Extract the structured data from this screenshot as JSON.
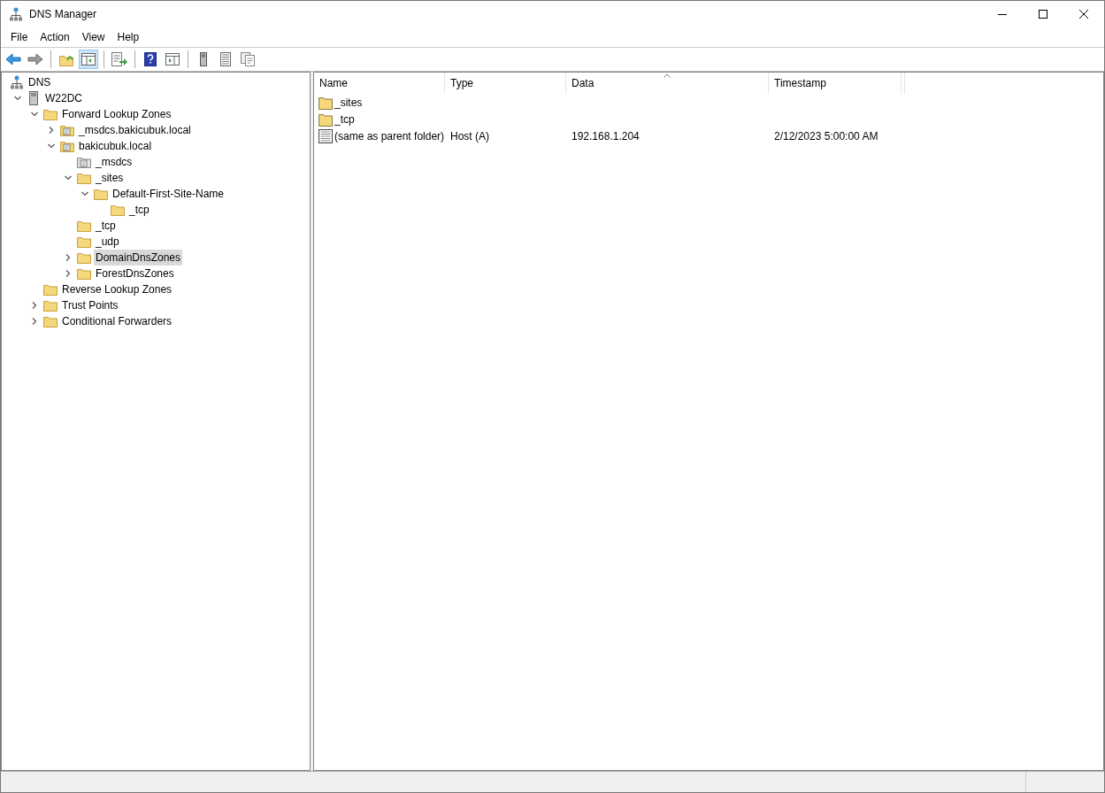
{
  "window": {
    "title": "DNS Manager"
  },
  "menu": [
    "File",
    "Action",
    "View",
    "Help"
  ],
  "toolbar": [
    {
      "kind": "back",
      "pressed": false
    },
    {
      "kind": "forward",
      "pressed": false
    },
    {
      "kind": "separator"
    },
    {
      "kind": "up",
      "pressed": false
    },
    {
      "kind": "tree",
      "pressed": true
    },
    {
      "kind": "separator"
    },
    {
      "kind": "export",
      "pressed": false
    },
    {
      "kind": "separator"
    },
    {
      "kind": "help",
      "pressed": false
    },
    {
      "kind": "pane",
      "pressed": false
    },
    {
      "kind": "separator"
    },
    {
      "kind": "server",
      "pressed": false
    },
    {
      "kind": "list",
      "pressed": false
    },
    {
      "kind": "copy",
      "pressed": false
    }
  ],
  "tree": {
    "label": "DNS",
    "kind": "dns",
    "selected": false,
    "children": [
      {
        "label": "W22DC",
        "kind": "server",
        "expanded": true,
        "selected": false,
        "children": [
          {
            "label": "Forward Lookup Zones",
            "kind": "folder",
            "expanded": true,
            "selected": false,
            "children": [
              {
                "label": "_msdcs.bakicubuk.local",
                "kind": "zone",
                "expanded": false,
                "selected": false
              },
              {
                "label": "bakicubuk.local",
                "kind": "zone",
                "expanded": true,
                "selected": false,
                "children": [
                  {
                    "label": "_msdcs",
                    "kind": "delegation",
                    "selected": false
                  },
                  {
                    "label": "_sites",
                    "kind": "folder",
                    "expanded": true,
                    "selected": false,
                    "children": [
                      {
                        "label": "Default-First-Site-Name",
                        "kind": "folder",
                        "expanded": true,
                        "selected": false,
                        "children": [
                          {
                            "label": "_tcp",
                            "kind": "folder",
                            "selected": false
                          }
                        ]
                      }
                    ]
                  },
                  {
                    "label": "_tcp",
                    "kind": "folder",
                    "selected": false
                  },
                  {
                    "label": "_udp",
                    "kind": "folder",
                    "selected": false
                  },
                  {
                    "label": "DomainDnsZones",
                    "kind": "folder",
                    "expanded": false,
                    "selected": true
                  },
                  {
                    "label": "ForestDnsZones",
                    "kind": "folder",
                    "expanded": false,
                    "selected": false
                  }
                ]
              }
            ]
          },
          {
            "label": "Reverse Lookup Zones",
            "kind": "folder",
            "selected": false
          },
          {
            "label": "Trust Points",
            "kind": "folder",
            "expanded": false,
            "selected": false
          },
          {
            "label": "Conditional Forwarders",
            "kind": "folder",
            "expanded": false,
            "selected": false
          }
        ]
      }
    ]
  },
  "list": {
    "columns": [
      {
        "label": "Name",
        "sorted": false
      },
      {
        "label": "Type",
        "sorted": false
      },
      {
        "label": "Data",
        "sorted": true
      },
      {
        "label": "Timestamp",
        "sorted": false
      }
    ],
    "rows": [
      {
        "kind": "folder",
        "name": "_sites"
      },
      {
        "kind": "folder",
        "name": "_tcp"
      },
      {
        "kind": "record",
        "name": "(same as parent folder)",
        "type": "Host (A)",
        "data": "192.168.1.204",
        "timestamp": "2/12/2023 5:00:00 AM"
      }
    ]
  }
}
